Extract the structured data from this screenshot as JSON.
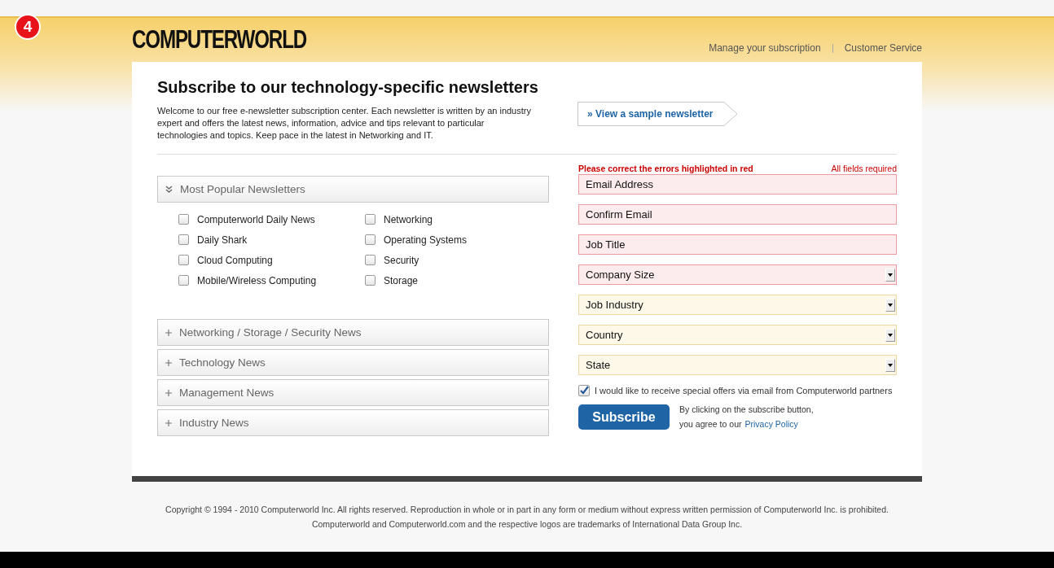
{
  "badge": "4",
  "logo": "COMPUTERWORLD",
  "header_links": [
    "Manage your subscription",
    "Customer Service"
  ],
  "title": "Subscribe to our technology-specific newsletters",
  "intro": "Welcome to our free e-newsletter subscription center. Each newsletter is written by an industry expert and offers the latest news, information, advice and tips relevant to particular technologies and topics. Keep pace in the latest in Networking and IT.",
  "sample_link": "» View a sample newsletter",
  "sections": [
    {
      "title": "Most Popular Newsletters",
      "expanded": true,
      "items": [
        {
          "label": "Computerworld Daily News",
          "checked": false
        },
        {
          "label": "Daily Shark",
          "checked": false
        },
        {
          "label": "Cloud Computing",
          "checked": false
        },
        {
          "label": "Mobile/Wireless Computing",
          "checked": false
        },
        {
          "label": "Networking",
          "checked": false
        },
        {
          "label": "Operating Systems",
          "checked": false
        },
        {
          "label": "Security",
          "checked": false
        },
        {
          "label": "Storage",
          "checked": false
        }
      ]
    },
    {
      "title": "Networking / Storage / Security News",
      "expanded": false
    },
    {
      "title": "Technology News",
      "expanded": false
    },
    {
      "title": "Management News",
      "expanded": false
    },
    {
      "title": "Industry News",
      "expanded": false
    }
  ],
  "form": {
    "error_message": "Please correct the errors highlighted in red",
    "required_note": "All fields required",
    "fields": [
      {
        "kind": "text",
        "placeholder": "Email Address",
        "error": true
      },
      {
        "kind": "text",
        "placeholder": "Confirm Email",
        "error": true
      },
      {
        "kind": "text",
        "placeholder": "Job Title",
        "error": true
      },
      {
        "kind": "select",
        "placeholder": "Company Size",
        "error": true
      },
      {
        "kind": "select",
        "placeholder": "Job Industry",
        "error": false
      },
      {
        "kind": "select",
        "placeholder": "Country",
        "error": false
      },
      {
        "kind": "select",
        "placeholder": "State",
        "error": false
      }
    ],
    "offers": {
      "label": "I would like to receive special offers via email from Computerworld partners",
      "checked": true
    },
    "submit": "Subscribe",
    "agreement": [
      "By clicking on the subscribe button,",
      "you agree to our"
    ],
    "privacy_link": "Privacy Policy"
  },
  "footer": "Copyright © 1994 - 2010 Computerworld Inc. All rights reserved. Reproduction in whole or in part in any form or medium without express written permission of Computerworld Inc. is prohibited. Computerworld and Computerworld.com and the respective logos are trademarks of International Data Group Inc."
}
